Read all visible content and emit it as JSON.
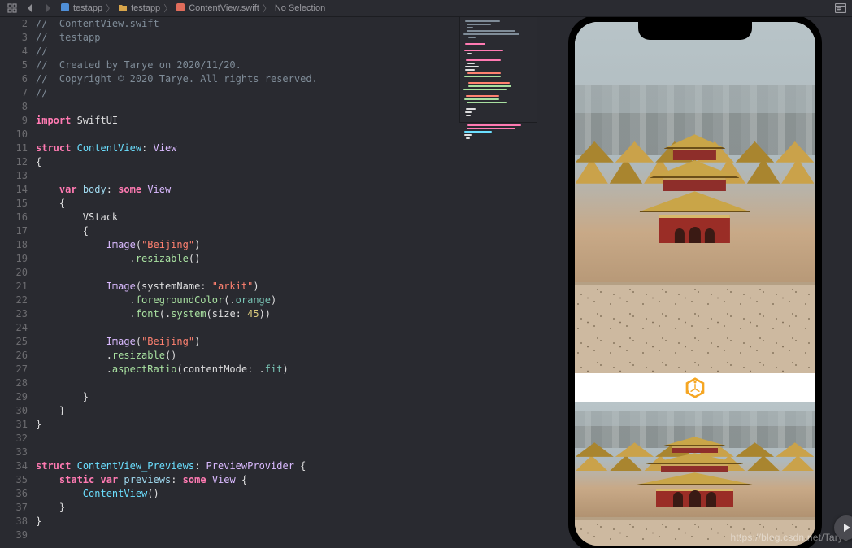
{
  "navbar": {
    "related": "related-items-icon",
    "back": "chevron-left-icon",
    "fwd": "chevron-right-icon",
    "panel": "panel-toggle-icon",
    "crumbs": [
      {
        "icon": "app",
        "label": "testapp"
      },
      {
        "icon": "folder",
        "label": "testapp"
      },
      {
        "icon": "swift",
        "label": "ContentView.swift"
      },
      {
        "icon": "",
        "label": "No Selection"
      }
    ]
  },
  "code": {
    "lines": [
      {
        "n": 2,
        "tokens": [
          [
            "c-comment",
            "//  ContentView.swift"
          ]
        ]
      },
      {
        "n": 3,
        "tokens": [
          [
            "c-comment",
            "//  testapp"
          ]
        ]
      },
      {
        "n": 4,
        "tokens": [
          [
            "c-comment",
            "//"
          ]
        ]
      },
      {
        "n": 5,
        "tokens": [
          [
            "c-comment",
            "//  Created by Tarye on 2020/11/20."
          ]
        ]
      },
      {
        "n": 6,
        "tokens": [
          [
            "c-comment",
            "//  Copyright © 2020 Tarye. All rights reserved."
          ]
        ]
      },
      {
        "n": 7,
        "tokens": [
          [
            "c-comment",
            "//"
          ]
        ]
      },
      {
        "n": 8,
        "tokens": []
      },
      {
        "n": 9,
        "tokens": [
          [
            "c-keyword",
            "import"
          ],
          [
            "c-plain",
            " SwiftUI"
          ]
        ]
      },
      {
        "n": 10,
        "tokens": []
      },
      {
        "n": 11,
        "tokens": [
          [
            "c-keyword",
            "struct"
          ],
          [
            "c-plain",
            " "
          ],
          [
            "c-type",
            "ContentView"
          ],
          [
            "c-plain",
            ": "
          ],
          [
            "c-typeSys",
            "View"
          ]
        ]
      },
      {
        "n": 12,
        "tokens": [
          [
            "c-plain",
            "{"
          ]
        ]
      },
      {
        "n": 13,
        "tokens": []
      },
      {
        "n": 14,
        "tokens": [
          [
            "c-plain",
            "    "
          ],
          [
            "c-keyword",
            "var"
          ],
          [
            "c-plain",
            " "
          ],
          [
            "c-methodSys",
            "body"
          ],
          [
            "c-plain",
            ": "
          ],
          [
            "c-keyword",
            "some"
          ],
          [
            "c-plain",
            " "
          ],
          [
            "c-typeSys",
            "View"
          ]
        ]
      },
      {
        "n": 15,
        "tokens": [
          [
            "c-plain",
            "    {"
          ]
        ]
      },
      {
        "n": 16,
        "tokens": [
          [
            "c-plain",
            "        VStack"
          ]
        ]
      },
      {
        "n": 17,
        "tokens": [
          [
            "c-plain",
            "        {"
          ]
        ]
      },
      {
        "n": 18,
        "tokens": [
          [
            "c-plain",
            "            "
          ],
          [
            "c-typeSys",
            "Image"
          ],
          [
            "c-plain",
            "("
          ],
          [
            "c-string",
            "\"Beijing\""
          ],
          [
            "c-plain",
            ")"
          ]
        ]
      },
      {
        "n": 19,
        "tokens": [
          [
            "c-plain",
            "                ."
          ],
          [
            "c-method",
            "resizable"
          ],
          [
            "c-plain",
            "()"
          ]
        ]
      },
      {
        "n": 20,
        "tokens": []
      },
      {
        "n": 21,
        "tokens": [
          [
            "c-plain",
            "            "
          ],
          [
            "c-typeSys",
            "Image"
          ],
          [
            "c-plain",
            "(systemName: "
          ],
          [
            "c-string",
            "\"arkit\""
          ],
          [
            "c-plain",
            ")"
          ]
        ]
      },
      {
        "n": 22,
        "tokens": [
          [
            "c-plain",
            "                ."
          ],
          [
            "c-method",
            "foregroundColor"
          ],
          [
            "c-plain",
            "(."
          ],
          [
            "c-prop",
            "orange"
          ],
          [
            "c-plain",
            ")"
          ]
        ]
      },
      {
        "n": 23,
        "tokens": [
          [
            "c-plain",
            "                ."
          ],
          [
            "c-method",
            "font"
          ],
          [
            "c-plain",
            "(."
          ],
          [
            "c-method",
            "system"
          ],
          [
            "c-plain",
            "(size: "
          ],
          [
            "c-number",
            "45"
          ],
          [
            "c-plain",
            "))"
          ]
        ]
      },
      {
        "n": 24,
        "tokens": []
      },
      {
        "n": 25,
        "tokens": [
          [
            "c-plain",
            "            "
          ],
          [
            "c-typeSys",
            "Image"
          ],
          [
            "c-plain",
            "("
          ],
          [
            "c-string",
            "\"Beijing\""
          ],
          [
            "c-plain",
            ")"
          ]
        ]
      },
      {
        "n": 26,
        "tokens": [
          [
            "c-plain",
            "            ."
          ],
          [
            "c-method",
            "resizable"
          ],
          [
            "c-plain",
            "()"
          ]
        ]
      },
      {
        "n": 27,
        "tokens": [
          [
            "c-plain",
            "            ."
          ],
          [
            "c-method",
            "aspectRatio"
          ],
          [
            "c-plain",
            "(contentMode: ."
          ],
          [
            "c-prop",
            "fit"
          ],
          [
            "c-plain",
            ")"
          ]
        ]
      },
      {
        "n": 28,
        "tokens": []
      },
      {
        "n": 29,
        "tokens": [
          [
            "c-plain",
            "        }"
          ]
        ]
      },
      {
        "n": 30,
        "tokens": [
          [
            "c-plain",
            "    }"
          ]
        ]
      },
      {
        "n": 31,
        "tokens": [
          [
            "c-plain",
            "}"
          ]
        ]
      },
      {
        "n": 32,
        "tokens": []
      },
      {
        "n": 33,
        "tokens": []
      },
      {
        "n": 34,
        "tokens": [
          [
            "c-keyword",
            "struct"
          ],
          [
            "c-plain",
            " "
          ],
          [
            "c-type",
            "ContentView_Previews"
          ],
          [
            "c-plain",
            ": "
          ],
          [
            "c-typeSys",
            "PreviewProvider"
          ],
          [
            "c-plain",
            " {"
          ]
        ]
      },
      {
        "n": 35,
        "tokens": [
          [
            "c-plain",
            "    "
          ],
          [
            "c-keyword",
            "static"
          ],
          [
            "c-plain",
            " "
          ],
          [
            "c-keyword",
            "var"
          ],
          [
            "c-plain",
            " "
          ],
          [
            "c-methodSys",
            "previews"
          ],
          [
            "c-plain",
            ": "
          ],
          [
            "c-keyword",
            "some"
          ],
          [
            "c-plain",
            " "
          ],
          [
            "c-typeSys",
            "View"
          ],
          [
            "c-plain",
            " {"
          ]
        ]
      },
      {
        "n": 36,
        "tokens": [
          [
            "c-plain",
            "        "
          ],
          [
            "c-type",
            "ContentView"
          ],
          [
            "c-plain",
            "()"
          ]
        ]
      },
      {
        "n": 37,
        "tokens": [
          [
            "c-plain",
            "    }"
          ]
        ]
      },
      {
        "n": 38,
        "tokens": [
          [
            "c-plain",
            "}"
          ]
        ]
      },
      {
        "n": 39,
        "tokens": []
      }
    ]
  },
  "minimap": [
    [
      "#7f8c98",
      50
    ],
    [
      "#7f8c98",
      35
    ],
    [
      "#7f8c98",
      10
    ],
    [
      "#7f8c98",
      70
    ],
    [
      "#7f8c98",
      80
    ],
    [
      "#7f8c98",
      10
    ],
    [
      "",
      0
    ],
    [
      "#ff7ab2",
      30
    ],
    [
      "",
      0
    ],
    [
      "#ff7ab2",
      55
    ],
    [
      "#dfdfe0",
      6
    ],
    [
      "",
      0
    ],
    [
      "#ff7ab2",
      50
    ],
    [
      "#dfdfe0",
      10
    ],
    [
      "#dfdfe0",
      20
    ],
    [
      "#dfdfe0",
      14
    ],
    [
      "#ff8170",
      48
    ],
    [
      "#a8e0a0",
      52
    ],
    [
      "",
      0
    ],
    [
      "#ff8170",
      60
    ],
    [
      "#a8e0a0",
      62
    ],
    [
      "#a8e0a0",
      62
    ],
    [
      "",
      0
    ],
    [
      "#ff8170",
      48
    ],
    [
      "#a8e0a0",
      50
    ],
    [
      "#a8e0a0",
      58
    ],
    [
      "",
      0
    ],
    [
      "#dfdfe0",
      14
    ],
    [
      "#dfdfe0",
      10
    ],
    [
      "#dfdfe0",
      6
    ],
    [
      "",
      0
    ],
    [
      "",
      0
    ],
    [
      "#ff7ab2",
      76
    ],
    [
      "#ff7ab2",
      70
    ],
    [
      "#6bdfff",
      40
    ],
    [
      "#dfdfe0",
      10
    ],
    [
      "#dfdfe0",
      6
    ]
  ],
  "preview": {
    "image1_alt": "Beijing",
    "image2_alt": "Beijing",
    "sf_symbol": "arkit",
    "accent_color": "#f5a623",
    "watermark": "https://blog.csdn.net/Tarye",
    "play_button": "live-preview-play"
  }
}
